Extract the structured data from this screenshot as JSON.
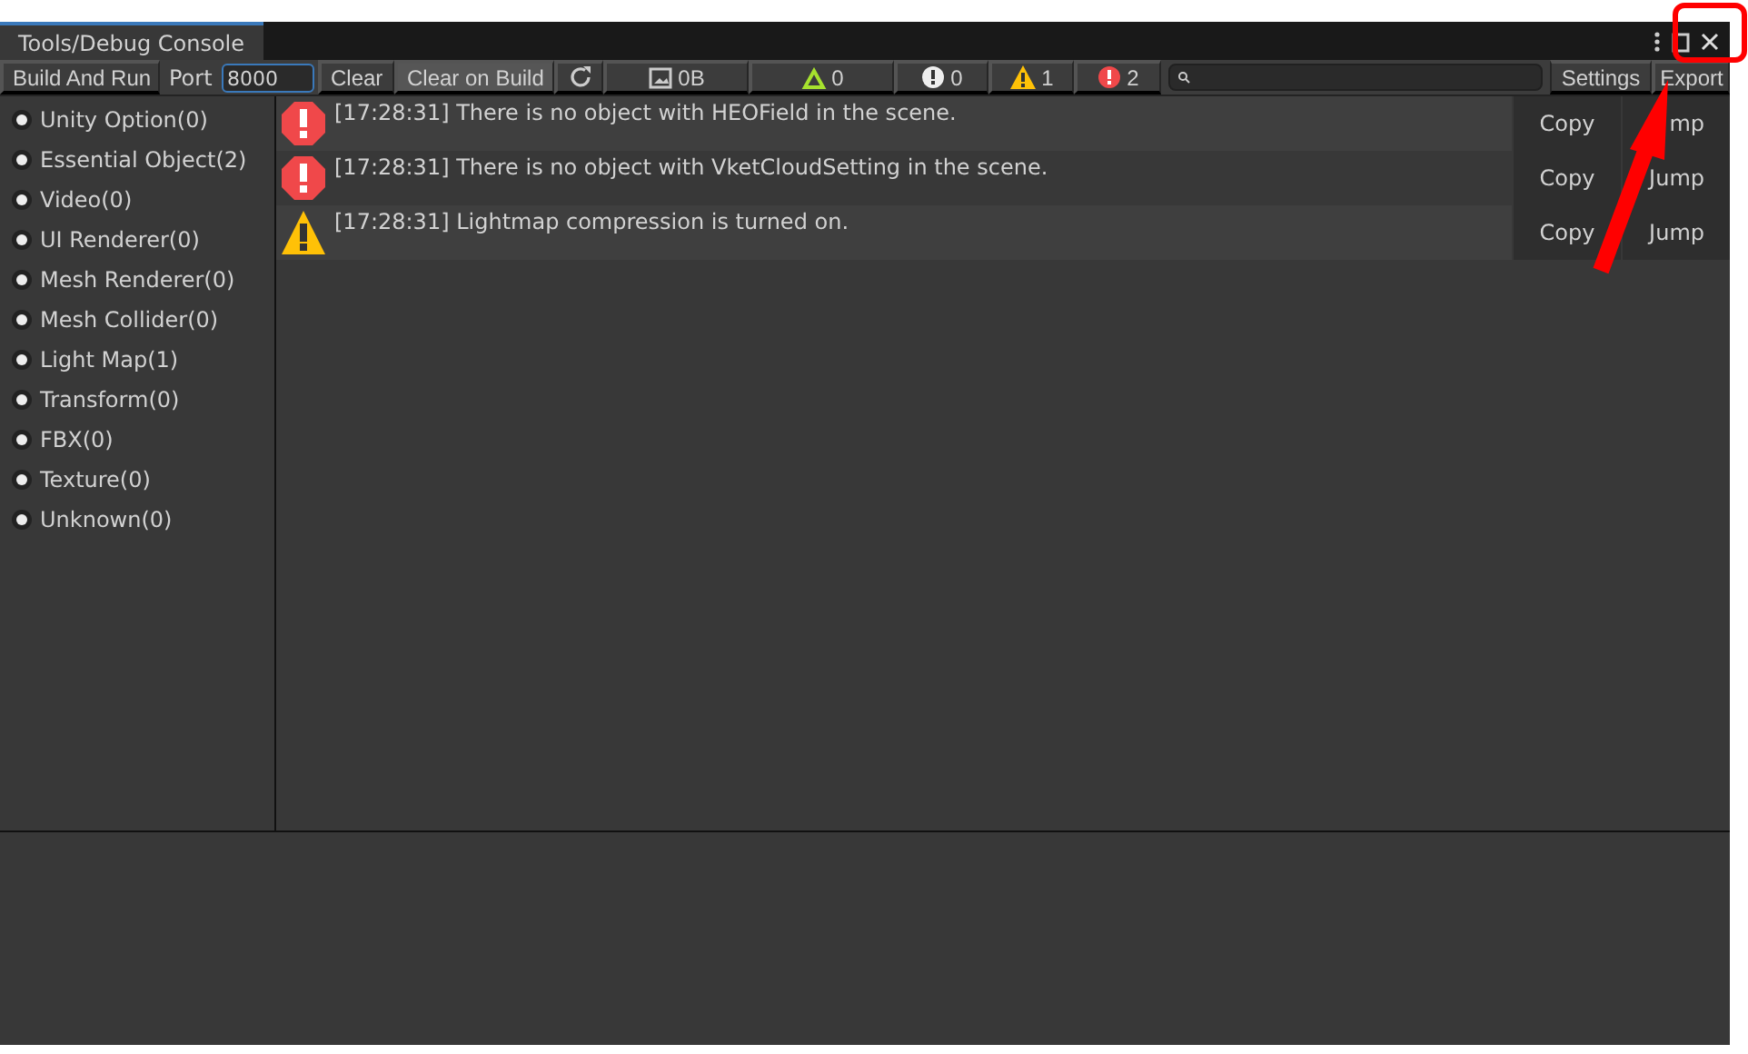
{
  "window": {
    "tab": "Tools/Debug Console"
  },
  "toolbar": {
    "build_button": "Build And Run",
    "port_label": "Port",
    "port_value": "8000",
    "clear_button": "Clear",
    "clear_on_build": {
      "label": "Clear on Build",
      "on": true
    },
    "counters": [
      {
        "kind": "memory",
        "label": "0B"
      },
      {
        "kind": "triangle",
        "label": "0"
      },
      {
        "kind": "info",
        "label": "0"
      },
      {
        "kind": "warning",
        "label": "1"
      },
      {
        "kind": "error",
        "label": "2"
      }
    ],
    "settings_button": "Settings",
    "export_button": "Export"
  },
  "sidebar": {
    "items": [
      {
        "label": "Unity Option(0)"
      },
      {
        "label": "Essential Object(2)"
      },
      {
        "label": "Video(0)"
      },
      {
        "label": "UI Renderer(0)"
      },
      {
        "label": "Mesh Renderer(0)"
      },
      {
        "label": "Mesh Collider(0)"
      },
      {
        "label": "Light Map(1)"
      },
      {
        "label": "Transform(0)"
      },
      {
        "label": "FBX(0)"
      },
      {
        "label": "Texture(0)"
      },
      {
        "label": "Unknown(0)"
      }
    ]
  },
  "log": [
    {
      "kind": "error",
      "message": "[17:28:31] There is no object with HEOField in the scene.",
      "copy": "Copy",
      "jump": "mp"
    },
    {
      "kind": "error",
      "message": "[17:28:31] There is no object with VketCloudSetting in the scene.",
      "copy": "Copy",
      "jump": "Jump"
    },
    {
      "kind": "warning",
      "message": "[17:28:31] Lightmap compression is turned on.",
      "copy": "Copy",
      "jump": "Jump"
    }
  ]
}
